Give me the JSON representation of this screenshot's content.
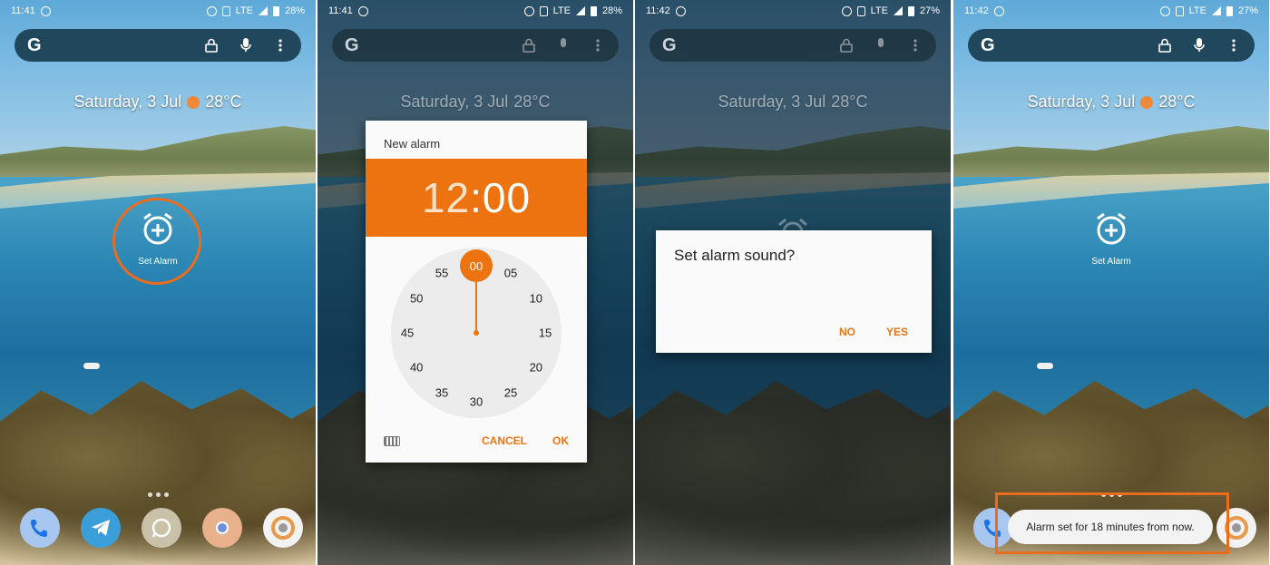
{
  "panels": [
    {
      "time": "11:41",
      "battery": "28%",
      "network": "LTE"
    },
    {
      "time": "11:41",
      "battery": "28%",
      "network": "LTE"
    },
    {
      "time": "11:42",
      "battery": "27%",
      "network": "LTE"
    },
    {
      "time": "11:42",
      "battery": "27%",
      "network": "LTE"
    }
  ],
  "search": {
    "logo": "G"
  },
  "date_widget": {
    "date": "Saturday, 3 Jul",
    "temperature": "28°C"
  },
  "shortcut": {
    "label": "Set Alarm"
  },
  "time_picker": {
    "title": "New alarm",
    "hour": "12",
    "separator": ":",
    "minute": "00",
    "selected": "00",
    "dial": [
      "05",
      "10",
      "15",
      "20",
      "25",
      "30",
      "35",
      "40",
      "45",
      "50",
      "55"
    ],
    "cancel": "CANCEL",
    "ok": "OK"
  },
  "sound_dialog": {
    "question": "Set alarm sound?",
    "no": "NO",
    "yes": "YES"
  },
  "toast": {
    "message": "Alarm set for 18 minutes from now."
  },
  "dock_icons": [
    "phone-icon",
    "telegram-icon",
    "whatsapp-icon",
    "chrome-icon",
    "camera-icon"
  ],
  "colors": {
    "accent": "#EC7310",
    "highlight": "#EA6C1F",
    "search_bg": "#21475C"
  }
}
